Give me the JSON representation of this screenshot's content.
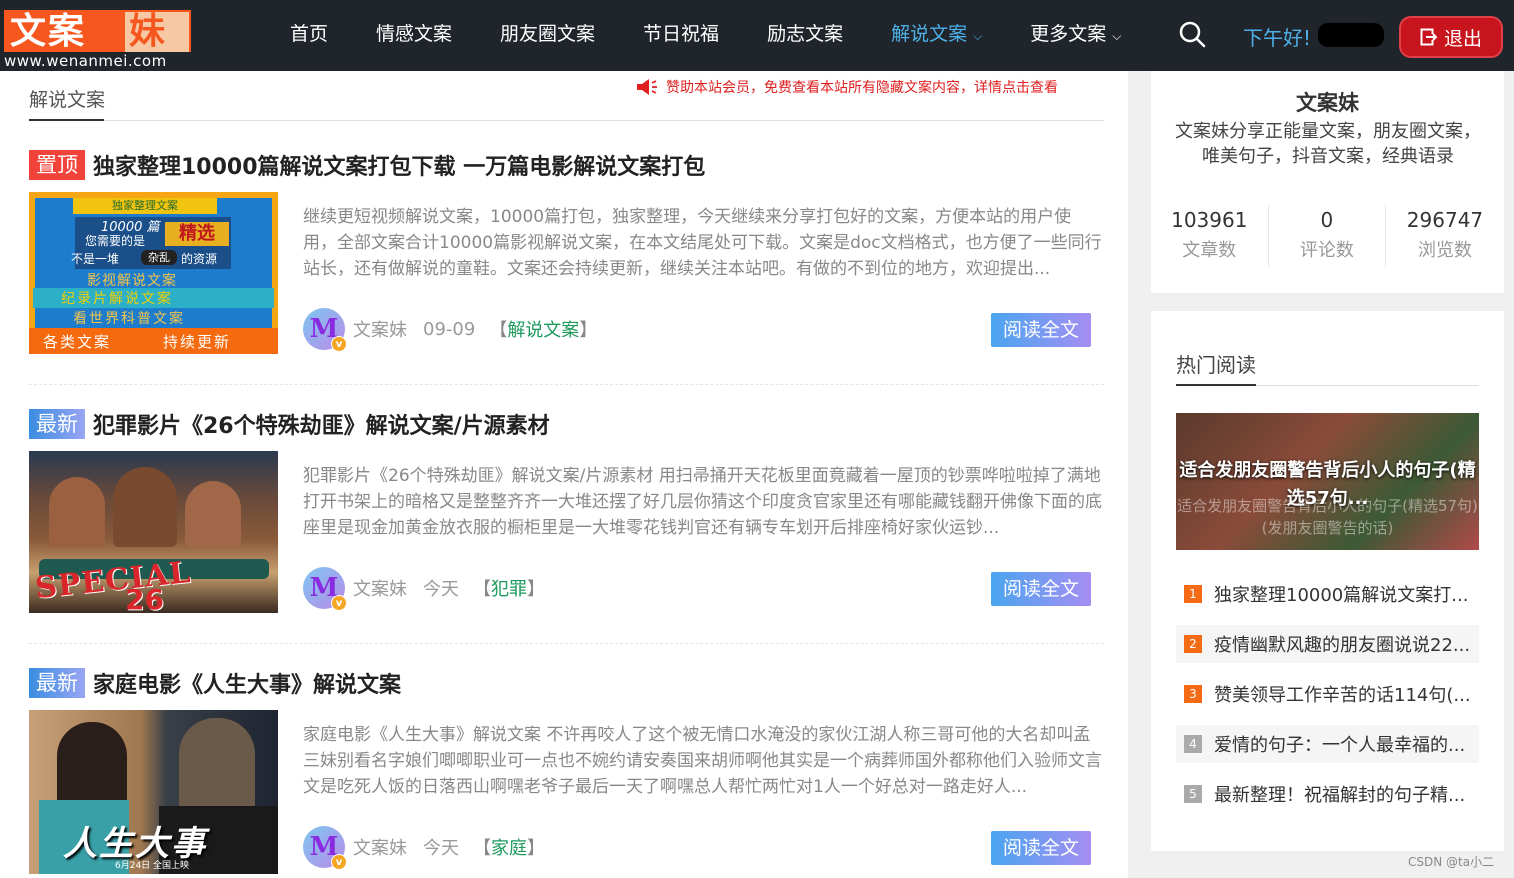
{
  "logo": {
    "part1": "文案",
    "part2": "妹",
    "url_text": "www.wenanmei.com"
  },
  "nav": {
    "items": [
      {
        "label": "首页"
      },
      {
        "label": "情感文案"
      },
      {
        "label": "朋友圈文案"
      },
      {
        "label": "节日祝福"
      },
      {
        "label": "励志文案"
      },
      {
        "label": "解说文案"
      },
      {
        "label": "更多文案"
      }
    ],
    "chevron": "⌵"
  },
  "header": {
    "greeting": "下午好!",
    "logout_label": "退出"
  },
  "section": {
    "title": "解说文案",
    "notice": "赞助本站会员，免费查看本站所有隐藏文案内容，详情点击查看"
  },
  "posts": [
    {
      "badge": "置顶",
      "title": "独家整理10000篇解说文案打包下载 一万篇电影解说文案打包",
      "excerpt": "继续更短视频解说文案，10000篇打包，独家整理，今天继续来分享打包好的文案，方便本站的用户使用，全部文案合计10000篇影视解说文案，在本文结尾处可下载。文案是doc文档格式，也方便了一些同行站长，还有做解说的童鞋。文案还会持续更新，继续关注本站吧。有做的不到位的地方，欢迎提出...",
      "author": "文案妹",
      "date": "09-09",
      "category": "解说文案",
      "read_label": "阅读全文",
      "thumb_lines": [
        "独家整理文案",
        "10000 篇",
        "您需要的是",
        "精选",
        "不是一堆",
        "杂乱",
        "的资源",
        "影视解说文案",
        "纪录片解说文案",
        "看世界科普文案",
        "各类文案",
        "持续更新"
      ]
    },
    {
      "badge": "最新",
      "title": "犯罪影片《26个特殊劫匪》解说文案/片源素材",
      "excerpt": "犯罪影片《26个特殊劫匪》解说文案/片源素材 用扫帚捅开天花板里面竟藏着一屋顶的钞票哗啦啦掉了满地打开书架上的暗格又是整整齐齐一大堆还摆了好几层你猜这个印度贪官家里还有哪能藏钱翻开佛像下面的底座里是现金加黄金放衣服的橱柜里是一大堆零花钱判官还有辆专车划开后排座椅好家伙运钞...",
      "author": "文案妹",
      "date": "今天",
      "category": "犯罪",
      "read_label": "阅读全文",
      "thumb_lines": [
        "SPECIAL",
        "26"
      ]
    },
    {
      "badge": "最新",
      "title": "家庭电影《人生大事》解说文案",
      "excerpt": "家庭电影《人生大事》解说文案 不许再咬人了这个被无情口水淹没的家伙江湖人称三哥可他的大名却叫孟三妹别看名字娘们唧唧职业可一点也不婉约请安奏国来胡师啊他其实是一个病葬师国外都称他们入验师文言文是吃死人饭的日落西山啊嘿老爷子最后一天了啊嘿总人帮忙两忙对1人一个好总对一路走好人...",
      "author": "文案妹",
      "date": "今天",
      "category": "家庭",
      "read_label": "阅读全文",
      "thumb_lines": [
        "人生大事",
        "6月24日 全国上映"
      ]
    }
  ],
  "sidebar": {
    "site_name": "文案妹",
    "site_desc": "文案妹分享正能量文案，朋友圈文案，唯美句子，抖音文案，经典语录",
    "stats": [
      {
        "num": "103961",
        "label": "文章数"
      },
      {
        "num": "0",
        "label": "评论数"
      },
      {
        "num": "296747",
        "label": "浏览数"
      }
    ],
    "hot_title": "热门阅读",
    "hot_image_caption": "适合发朋友圈警告背后小人的句子(精选57句...",
    "hot_image_watermark": "适合发朋友圈警告背后小人的句子(精选57句)(发朋友圈警告的话)",
    "hot_items": [
      {
        "rank": "1",
        "title": "独家整理10000篇解说文案打..."
      },
      {
        "rank": "2",
        "title": "疫情幽默风趣的朋友圈说说22..."
      },
      {
        "rank": "3",
        "title": "赞美领导工作辛苦的话114句(..."
      },
      {
        "rank": "4",
        "title": "爱情的句子：一个人最幸福的..."
      },
      {
        "rank": "5",
        "title": "最新整理！祝福解封的句子精..."
      }
    ]
  },
  "watermark": "CSDN @ta小二",
  "colors": {
    "header_bg": "#1f252b",
    "accent_blue": "#4fb0e8",
    "logout_red": "#c8141c",
    "badge_red": "#f2433b",
    "category_green": "#1d9a5c"
  }
}
